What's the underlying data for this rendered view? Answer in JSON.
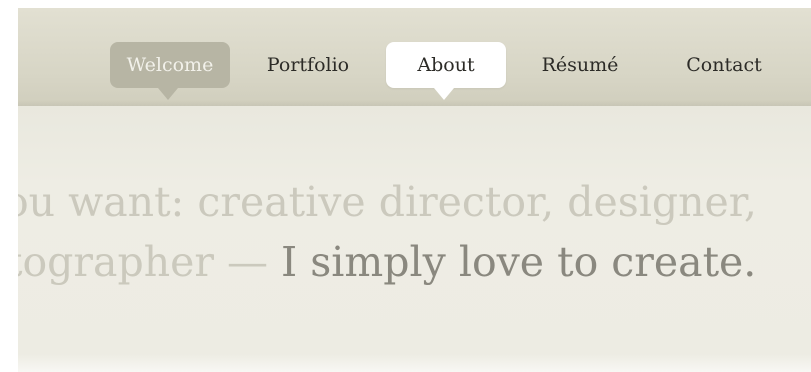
{
  "nav": {
    "items": [
      {
        "label": "Welcome"
      },
      {
        "label": "Portfolio"
      },
      {
        "label": "About"
      },
      {
        "label": "Résumé"
      },
      {
        "label": "Contact"
      }
    ],
    "selected": "About",
    "hover": "Welcome"
  },
  "hero": {
    "line1": "ou want: creative director, designer,",
    "line2_muted": "tographer — ",
    "line2_strong": "I simply love to create."
  },
  "colors": {
    "nav_band": "#d7d5c5",
    "content_bg": "#ecebe1",
    "welcome_pill": "#b7b5a4",
    "about_pill": "#ffffff",
    "muted_text": "#cbc9bd",
    "strong_text": "#8a887f"
  }
}
